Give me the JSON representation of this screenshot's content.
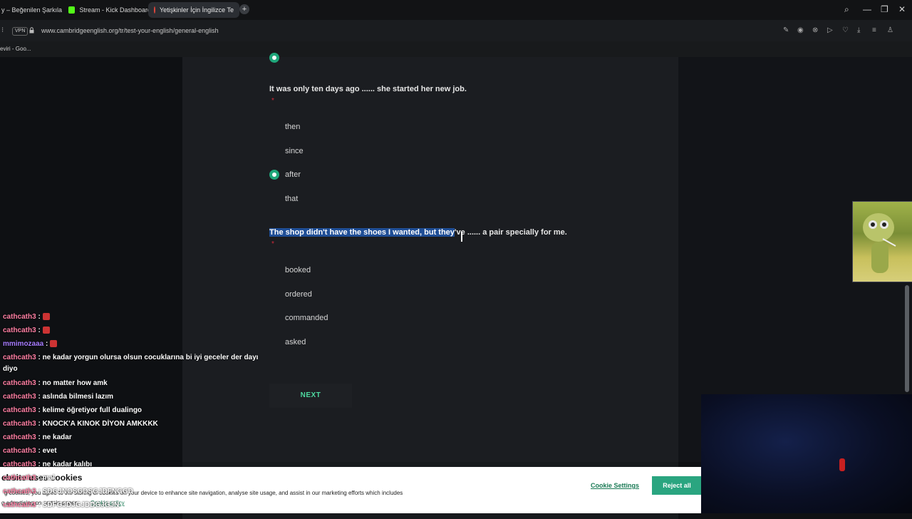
{
  "browser": {
    "tabs": [
      {
        "label": "y – Beğenilen Şarkıla",
        "active": false
      },
      {
        "label": "Stream - Kick Dashboard",
        "active": false
      },
      {
        "label": "Yetişkinler İçin İngilizce Te",
        "active": true
      }
    ],
    "vpn_label": "VPN",
    "url": "www.cambridgeenglish.org/tr/test-your-english/general-english",
    "bookmark": "eviri - Goo..."
  },
  "quiz": {
    "questions": [
      {
        "text": "It was only ten days ago ...... she started her new job.",
        "required_mark": "*",
        "options": [
          "then",
          "since",
          "after",
          "that"
        ],
        "selected": "after"
      },
      {
        "text_highlighted": "The shop didn't have the shoes I wanted, but they",
        "text_rest": "'ve ...... a pair specially for me.",
        "required_mark": "*",
        "options": [
          "booked",
          "ordered",
          "commanded",
          "asked"
        ],
        "selected": null
      }
    ],
    "next_label": "NEXT"
  },
  "cookie_banner": {
    "title": "ebsite uses cookies",
    "text": "g cookies, you agree to the storing of cookies on your device to enhance site navigation, analyse site usage, and assist in our marketing efforts which includes",
    "text2": "g advertising on certain pages.",
    "policy_link": "Cookie policy",
    "settings_label": "Cookie Settings",
    "reject_label": "Reject all"
  },
  "chat": [
    {
      "user": "cathcath3",
      "message": ":"
    },
    {
      "user": "cathcath3",
      "message": ":"
    },
    {
      "user": "mmimozaaa",
      "message": ":"
    },
    {
      "user": "cathcath3",
      "message": ": ne kadar yorgun olursa olsun cocuklarına bi iyi geceler der dayı diyo"
    },
    {
      "user": "cathcath3",
      "message": ": no matter how amk"
    },
    {
      "user": "cathcath3",
      "message": ": aslında bilmesi lazım"
    },
    {
      "user": "cathcath3",
      "message": ": kelime öğretiyor full dualingo"
    },
    {
      "user": "cathcath3",
      "message": ": KNOCK'A KINOK DİYON AMKKKK"
    },
    {
      "user": "cathcath3",
      "message": ": ne kadar"
    },
    {
      "user": "cathcath3",
      "message": ": evet"
    },
    {
      "user": "cathcath3",
      "message": ": ne kadar kalıbı"
    },
    {
      "user": "cathcath3",
      "message": ": mal"
    },
    {
      "user": "cathcath3",
      "message": ": SDGJNOSGDSGJDFNGGD"
    },
    {
      "user": "cathcath3",
      "message": ": SDFGJDJGJDDGJGJN"
    }
  ],
  "colors": {
    "accent": "#1fa67a",
    "next_text": "#4ed9a0",
    "highlight": "#1f4e96",
    "required": "#d02a3a",
    "chat_user": "#ff7fa3"
  }
}
